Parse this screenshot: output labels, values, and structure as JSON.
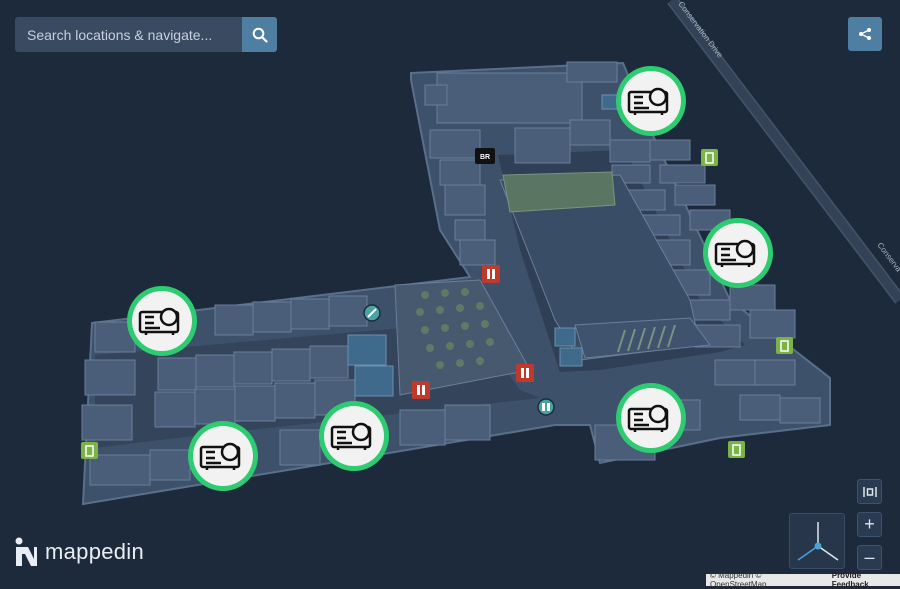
{
  "search": {
    "placeholder": "Search locations & navigate..."
  },
  "icons": {
    "search": "search-icon",
    "share": "share-icon",
    "projector": "projector-icon",
    "exit": "exit-door-icon",
    "restroom": "restroom-icon",
    "info": "info-icon"
  },
  "map": {
    "roads": [
      "Conservation Drive",
      "Conserva"
    ],
    "store_code": "BR"
  },
  "controls": {
    "zoom_in": "+",
    "zoom_out": "–"
  },
  "logo": {
    "text": "mappedin"
  },
  "attribution": {
    "text": "© Mappedin © OpenStreetMap",
    "feedback": "Provide Feedback"
  },
  "colors": {
    "background": "#1d2a3c",
    "accent": "#4e7fa3",
    "marker_ring": "#2ecc71",
    "exit_green": "#7bb346",
    "restroom_red": "#c0392b"
  }
}
